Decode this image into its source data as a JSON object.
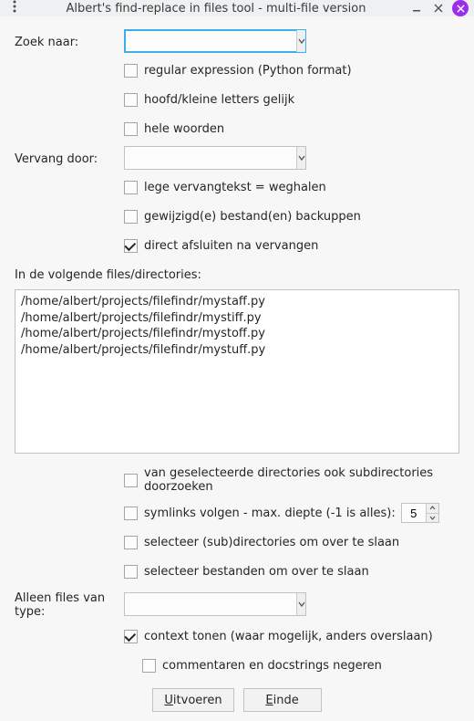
{
  "window": {
    "title": "Albert's find-replace in files tool - multi-file version"
  },
  "search": {
    "label": "Zoek naar:",
    "value": "",
    "regex_label": "regular expression (Python format)",
    "regex_checked": false,
    "case_label": "hoofd/kleine letters gelijk",
    "case_checked": false,
    "whole_words_label": "hele woorden",
    "whole_words_checked": false
  },
  "replace": {
    "label": "Vervang door:",
    "value": "",
    "empty_remove_label": "lege vervangtekst = weghalen",
    "empty_remove_checked": false,
    "backup_label": "gewijzigd(e) bestand(en) backuppen",
    "backup_checked": false,
    "close_after_label": "direct afsluiten na vervangen",
    "close_after_checked": true
  },
  "files_section": {
    "label": "In de volgende files/directories:",
    "items": [
      "/home/albert/projects/filefindr/mystaff.py",
      "/home/albert/projects/filefindr/mystiff.py",
      "/home/albert/projects/filefindr/mystoff.py",
      "/home/albert/projects/filefindr/mystuff.py"
    ]
  },
  "options": {
    "recurse_label": "van geselecteerde directories ook subdirectories doorzoeken",
    "recurse_checked": false,
    "symlinks_label": "symlinks volgen - max. diepte (-1 is alles):",
    "symlinks_checked": false,
    "symlinks_depth": "5",
    "skip_dirs_label": "selecteer (sub)directories om over te slaan",
    "skip_dirs_checked": false,
    "skip_files_label": "selecteer bestanden om over te slaan",
    "skip_files_checked": false
  },
  "filetype": {
    "label": "Alleen files van type:",
    "value": "",
    "context_label": "context tonen (waar mogelijk, anders overslaan)",
    "context_checked": true,
    "comments_label": "commentaren en docstrings negeren",
    "comments_checked": false
  },
  "buttons": {
    "execute_u": "U",
    "execute_rest": "itvoeren",
    "end_u": "E",
    "end_rest": "inde"
  }
}
